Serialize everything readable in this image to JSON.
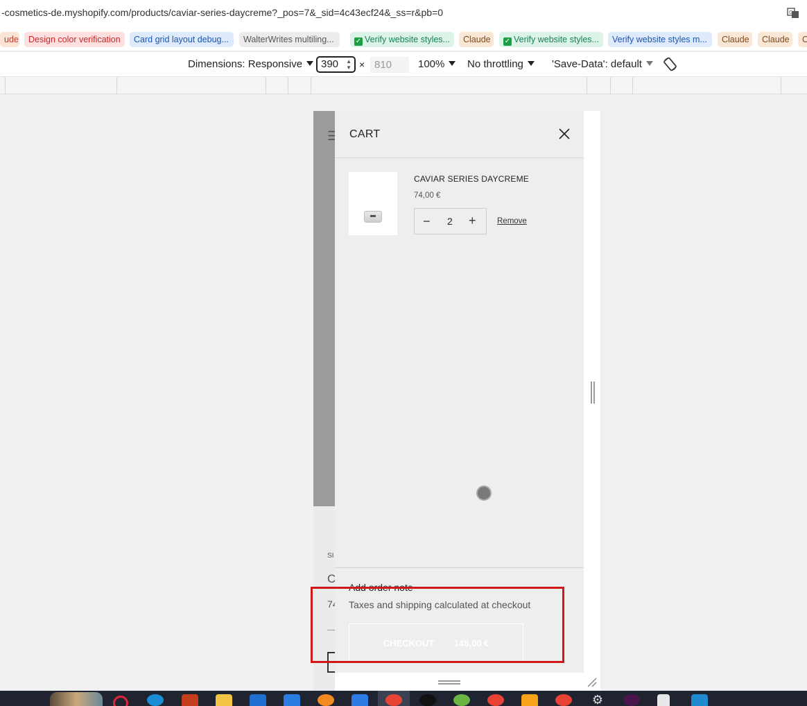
{
  "browser": {
    "url": "-cosmetics-de.myshopify.com/products/caviar-series-daycreme?_pos=7&_sid=4c43ecf24&_ss=r&pb=0",
    "bookmarks": [
      {
        "label": "ude",
        "color": "#c0392b",
        "bg": "#fbe3d6"
      },
      {
        "label": "Design color verification",
        "color": "#c62828",
        "bg": "#fde0df"
      },
      {
        "label": "Card grid layout debug...",
        "color": "#1a56b0",
        "bg": "#dfeafc"
      },
      {
        "label": "WalterWrites multiling...",
        "color": "#555555",
        "bg": "#ececec"
      },
      {
        "label": "Verify website styles...",
        "color": "#16805a",
        "bg": "#dcf3e8",
        "check": true
      },
      {
        "label": "Claude",
        "color": "#7a4a1e",
        "bg": "#fbe7d5"
      },
      {
        "label": "Verify website styles...",
        "color": "#16805a",
        "bg": "#dcf3e8",
        "check": true
      },
      {
        "label": "Verify website styles m...",
        "color": "#1a56b0",
        "bg": "#dfeafc"
      },
      {
        "label": "Claude",
        "color": "#7a4a1e",
        "bg": "#fbe7d5"
      },
      {
        "label": "Claude",
        "color": "#7a4a1e",
        "bg": "#fbe7d5"
      },
      {
        "label": "C",
        "color": "#7a4a1e",
        "bg": "#fbe7d5"
      }
    ]
  },
  "devtools": {
    "dimensions_label": "Dimensions: Responsive",
    "width": "390",
    "times": "×",
    "height": "810",
    "zoom": "100%",
    "throttling": "No throttling",
    "save_data": "'Save-Data': default"
  },
  "page_behind": {
    "letter_si": "SI",
    "letter_c": "C",
    "letter_74": "74"
  },
  "cart": {
    "title": "CART",
    "item": {
      "name": "CAVIAR SERIES DAYCREME",
      "price": "74,00 €",
      "quantity": "2",
      "minus": "−",
      "plus": "+",
      "remove_label": "Remove"
    },
    "order_note_label": "Add order note",
    "taxes_text": "Taxes and shipping calculated at checkout",
    "checkout_label": "CHECKOUT",
    "checkout_separator": "·",
    "checkout_total": "148,00 €"
  },
  "colors": {
    "accent_highlight": "#d01818",
    "drawer_bg": "#eeeeee",
    "taskbar_bg": "#1f2430"
  }
}
